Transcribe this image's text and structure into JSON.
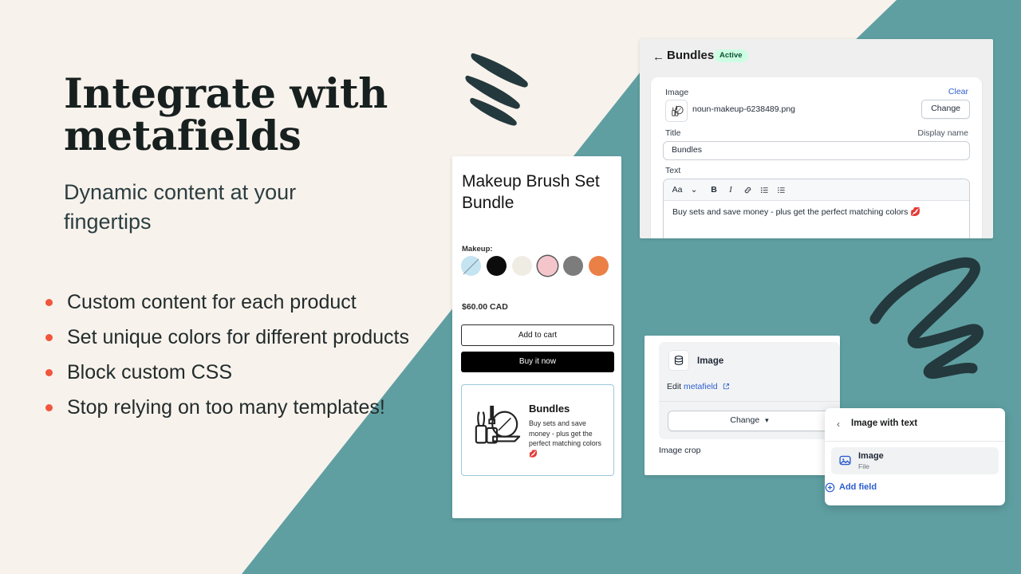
{
  "palette": {
    "teal": "#5F9FA2",
    "cream": "#F8F2EC",
    "ink": "#17201F",
    "bullet_orange": "#F0563C",
    "link_blue": "#2C5ECF",
    "badge_green_bg": "#CDFEE3",
    "badge_green_fg": "#0F5132"
  },
  "hero": {
    "headline_line1": "Integrate with",
    "headline_line2": "metafields",
    "subhead": "Dynamic content at your fingertips",
    "bullets": [
      "Custom content for each product",
      "Set unique colors for different products",
      "Block custom CSS",
      "Stop relying on too many templates!"
    ]
  },
  "bundles_panel": {
    "back_icon": "arrow-left-icon",
    "title": "Bundles",
    "status_badge": "Active",
    "image_label": "Image",
    "clear_label": "Clear",
    "image_filename": "noun-makeup-6238489.png",
    "change_label": "Change",
    "title_label": "Title",
    "display_name_label": "Display name",
    "title_value": "Bundles",
    "text_label": "Text",
    "toolbar": {
      "font_size_label": "Aa",
      "chevron": "chevron-down-icon",
      "bold": "B",
      "italic": "I",
      "link": "link-icon",
      "bullet_list": "bulleted-list-icon",
      "numbered_list": "numbered-list-icon"
    },
    "text_value": "Buy sets and save money - plus get the perfect matching colors 💋"
  },
  "product_card": {
    "title": "Makeup Brush Set Bundle",
    "option_label": "Makeup:",
    "swatches": [
      {
        "name": "light-blue",
        "color": "#C4E4F2",
        "selected": false,
        "unavailable": true
      },
      {
        "name": "black",
        "color": "#0C0C0C",
        "selected": false,
        "unavailable": false
      },
      {
        "name": "cream",
        "color": "#EFECE4",
        "selected": false,
        "unavailable": false
      },
      {
        "name": "pink",
        "color": "#F4C6CC",
        "selected": true,
        "unavailable": false
      },
      {
        "name": "gray",
        "color": "#7C7C7C",
        "selected": false,
        "unavailable": false
      },
      {
        "name": "orange",
        "color": "#EB8047",
        "selected": false,
        "unavailable": false
      }
    ],
    "price": "$60.00 CAD",
    "add_to_cart_label": "Add to cart",
    "buy_now_label": "Buy it now",
    "bundle_heading": "Bundles",
    "bundle_text": "Buy sets and save money - plus get the perfect matching colors 💋"
  },
  "editor_panel": {
    "block_icon": "database-icon",
    "block_title": "Image",
    "edit_prefix": "Edit ",
    "edit_link": "metafield",
    "external_icon": "external-link-icon",
    "change_label": "Change",
    "change_chevron": "chevron-down-icon",
    "image_crop_label": "Image crop"
  },
  "popover": {
    "back_icon": "chevron-left-icon",
    "title": "Image with text",
    "row_icon": "image-icon",
    "row_title": "Image",
    "row_subtitle": "File",
    "add_field_icon": "plus-circle-icon",
    "add_field_label": "Add field"
  },
  "decorations": {
    "brush_strokes": "three-diagonal-brush-strokes",
    "squiggle": "zigzag-squiggle"
  }
}
